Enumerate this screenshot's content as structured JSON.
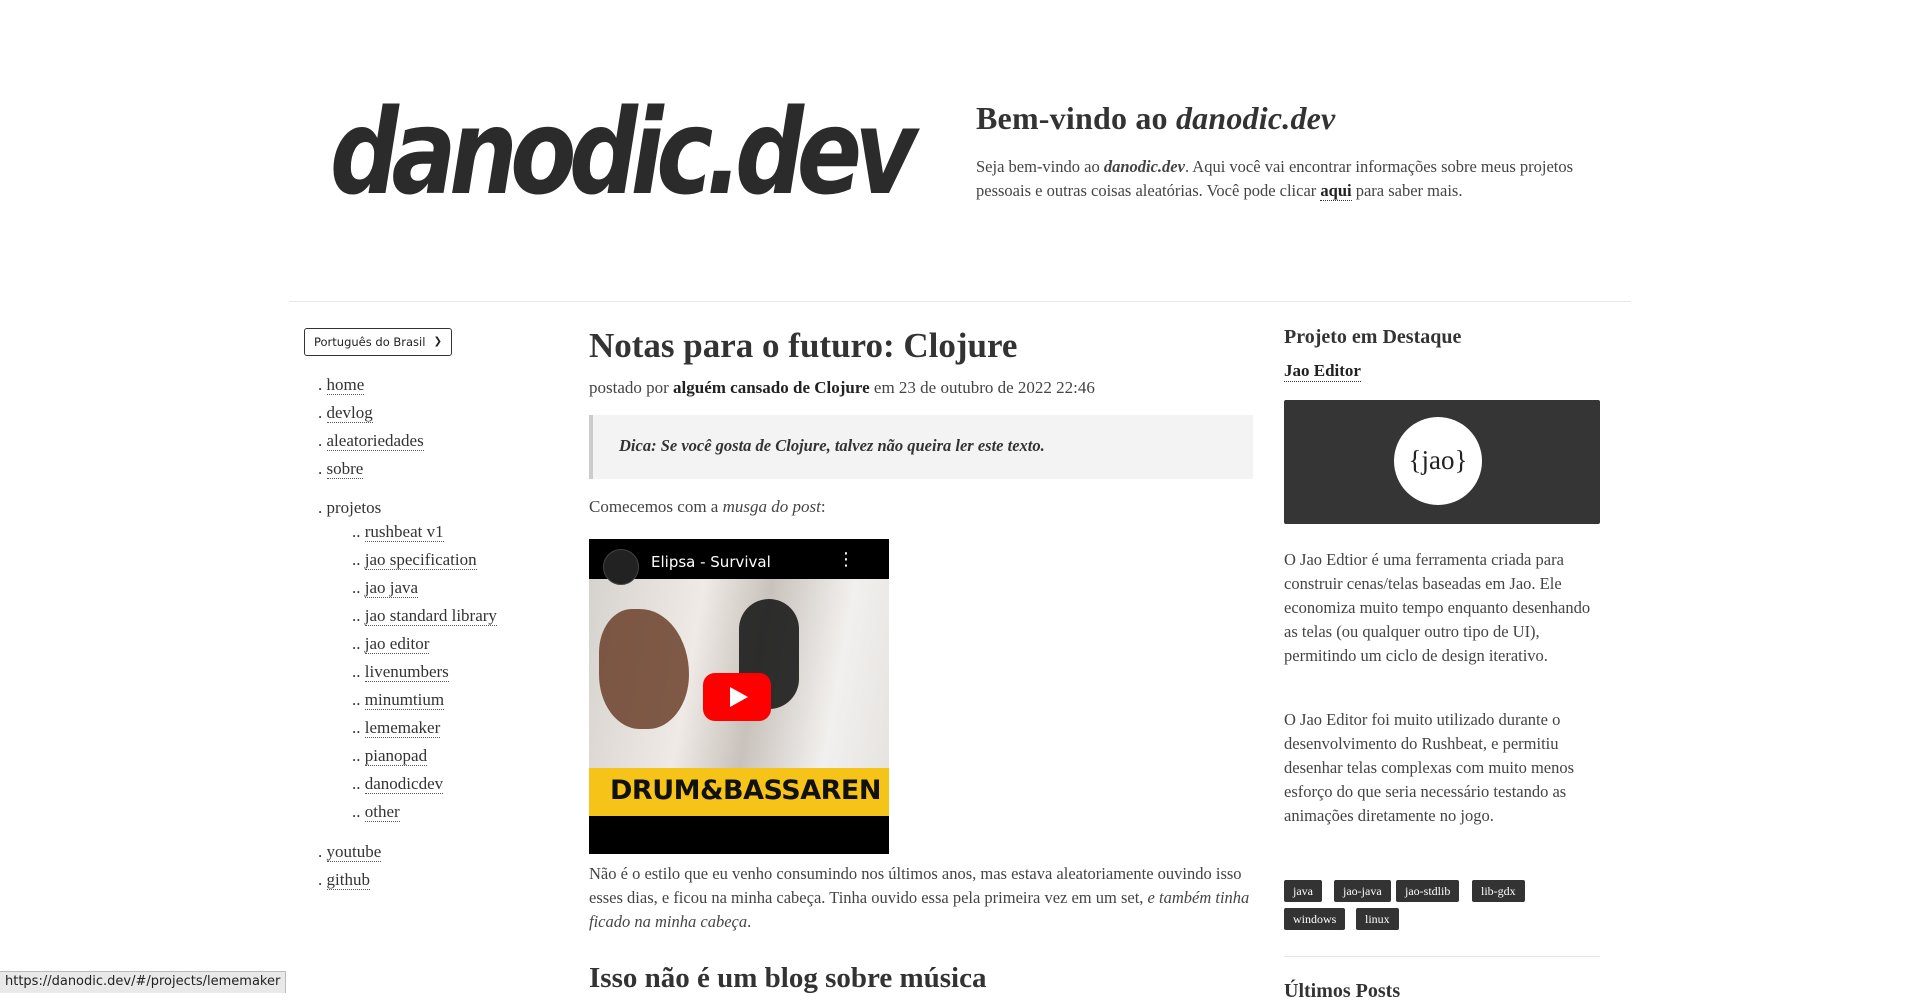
{
  "header": {
    "logo_text": "danodic.dev",
    "title_prefix": "Bem-vindo ao ",
    "title_site": "danodic.dev",
    "intro_before": "Seja bem-vindo ao ",
    "intro_site": "danodic.dev",
    "intro_middle": ". Aqui você vai encontrar informações sobre meus projetos pessoais e outras coisas aleatórias. Você pode clicar ",
    "intro_link": "aqui",
    "intro_after": " para saber mais."
  },
  "sidebar": {
    "language": "Português do Brasil",
    "prefix1": ".",
    "prefix2": "..",
    "items": [
      {
        "label": "home"
      },
      {
        "label": "devlog"
      },
      {
        "label": "aleatoriedades"
      },
      {
        "label": "sobre"
      }
    ],
    "projects_label": "projetos",
    "projects": [
      {
        "label": "rushbeat v1"
      },
      {
        "label": "jao specification"
      },
      {
        "label": "jao java"
      },
      {
        "label": "jao standard library"
      },
      {
        "label": "jao editor"
      },
      {
        "label": "livenumbers"
      },
      {
        "label": "minumtium"
      },
      {
        "label": "lememaker"
      },
      {
        "label": "pianopad"
      },
      {
        "label": "danodicdev"
      },
      {
        "label": "other"
      }
    ],
    "external": [
      {
        "label": "youtube"
      },
      {
        "label": "github"
      }
    ]
  },
  "post": {
    "title": "Notas para o futuro: Clojure",
    "posted_by": "postado por ",
    "author": "alguém cansado de Clojure",
    "date": " em 23 de outubro de 2022 22:46",
    "tip": "Dica: Se você gosta de Clojure, talvez não queira ler este texto.",
    "intro_before": "Comecemos com a ",
    "intro_em": "musga do post",
    "intro_after": ":",
    "video_title": "Elipsa - Survival",
    "video_band": "DRUM&BASSAREN",
    "paragraph_main": "Não é o estilo que eu venho consumindo nos últimos anos, mas estava aleatoriamente ouvindo isso esses dias, e ficou na minha cabeça. Tinha ouvido essa pela primeira vez em um set, ",
    "paragraph_em": "e também tinha ficado na minha cabeça",
    "paragraph_end": ".",
    "next_heading": "Isso não é um blog sobre música"
  },
  "featured": {
    "heading": "Projeto em Destaque",
    "project_link": "Jao Editor",
    "banner_text": "{jao}",
    "description_1": "O Jao Edtior é uma ferramenta criada para construir cenas/telas baseadas em Jao. Ele economiza muito tempo enquanto desenhando as telas (ou qualquer outro tipo de UI), permitindo um ciclo de design iterativo.",
    "description_2": "O Jao Editor foi muito utilizado durante o desenvolvimento do Rushbeat, e permitiu desenhar telas complexas com muito menos esforço do que seria necessário testando as animações diretamente no jogo.",
    "tags": [
      "java",
      "jao-java",
      "jao-stdlib",
      "lib-gdx",
      "windows",
      "linux"
    ],
    "recent_heading": "Últimos Posts"
  },
  "statusbar": {
    "url": "https://danodic.dev/#/projects/lememaker"
  }
}
